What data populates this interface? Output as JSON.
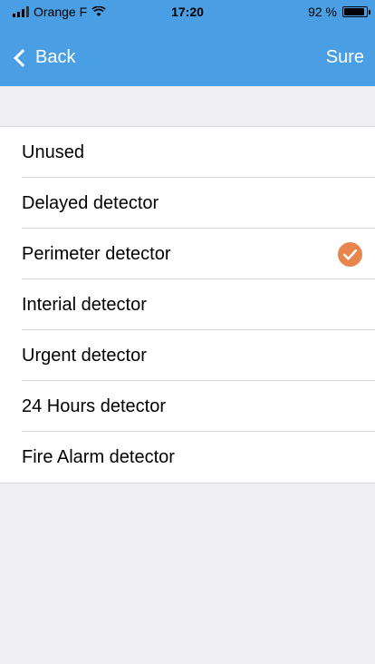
{
  "status_bar": {
    "carrier": "Orange F",
    "time": "17:20",
    "battery": "92 %",
    "battery_level": 0.92
  },
  "nav": {
    "back_label": "Back",
    "sure_label": "Sure"
  },
  "list": {
    "selected_index": 2,
    "items": [
      {
        "label": "Unused"
      },
      {
        "label": "Delayed detector"
      },
      {
        "label": "Perimeter detector"
      },
      {
        "label": "Interial detector"
      },
      {
        "label": "Urgent detector"
      },
      {
        "label": "24 Hours detector"
      },
      {
        "label": "Fire Alarm detector"
      }
    ]
  },
  "colors": {
    "header": "#4a9ee3",
    "check": "#e8854c",
    "background": "#efeff4"
  }
}
